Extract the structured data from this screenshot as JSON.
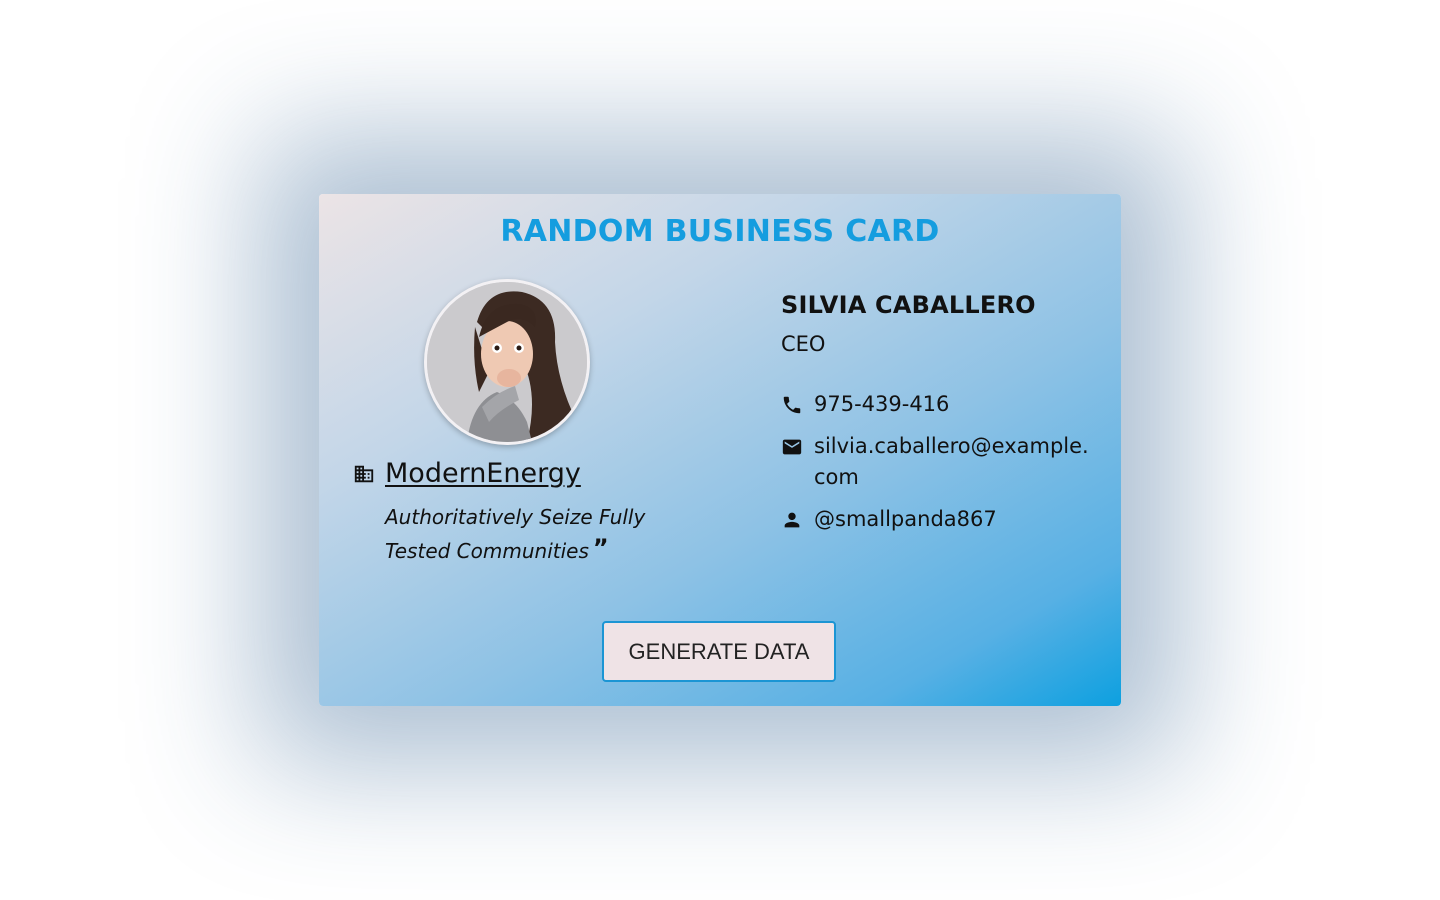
{
  "card": {
    "title": "RANDOM BUSINESS CARD",
    "avatar_alt": "profile photo",
    "company": {
      "icon": "building-icon",
      "name": "ModernEnergy",
      "slogan": "Authoritatively Seize Fully Tested Communities",
      "quote_mark": "”"
    },
    "person": {
      "name": "SILVIA CABALLERO",
      "role": "CEO"
    },
    "contacts": {
      "phone": {
        "icon": "phone-icon",
        "value": "975-439-416"
      },
      "email": {
        "icon": "mail-icon",
        "value": "silvia.caballero@example.com"
      },
      "username": {
        "icon": "person-icon",
        "value": "@smallpanda867"
      }
    },
    "button_label": "GENERATE DATA"
  },
  "colors": {
    "title": "#159ddf",
    "button_border": "#1b95d4",
    "button_bg": "#efe3e6",
    "gradient_start": "#ece4e6",
    "gradient_end": "#0da0e0"
  }
}
